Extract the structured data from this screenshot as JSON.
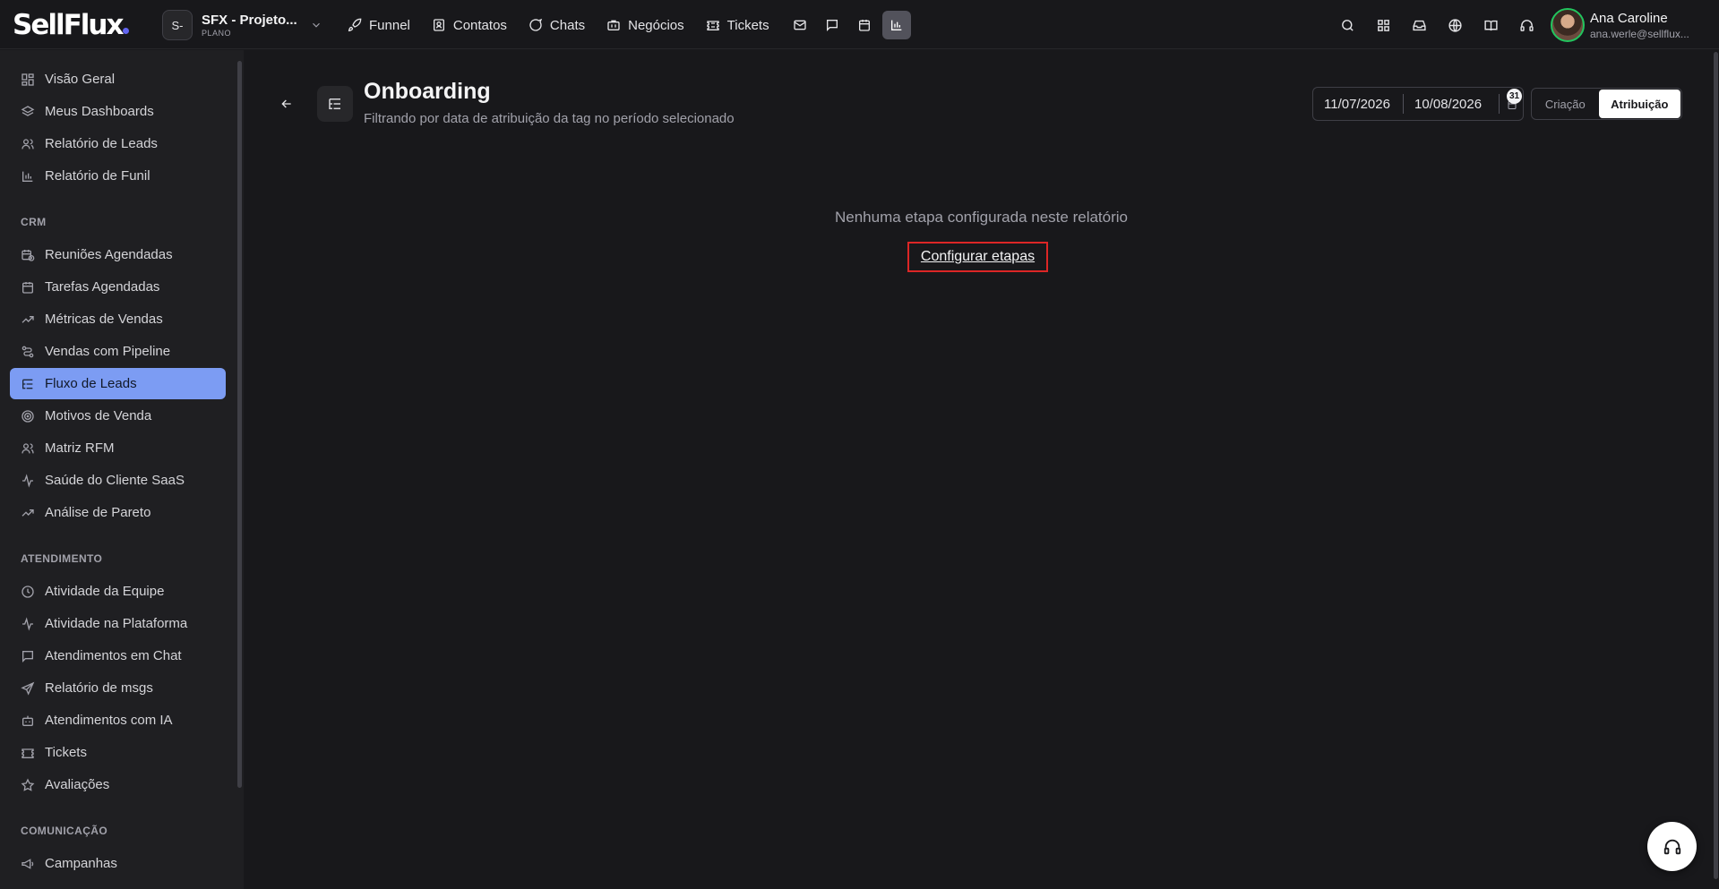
{
  "brand": {
    "logo_text": "SellFlux",
    "accent": "#6366f1"
  },
  "workspace": {
    "initials": "S-",
    "name": "SFX - Projeto...",
    "plan": "PLANO"
  },
  "topnav": {
    "funnel": "Funnel",
    "contatos": "Contatos",
    "chats": "Chats",
    "negocios": "Negócios",
    "tickets": "Tickets",
    "icon_buttons": [
      "mail-icon",
      "message-icon",
      "calendar-icon",
      "bar-chart-icon"
    ],
    "active_icon": "bar-chart-icon"
  },
  "right_icons": [
    "search-icon",
    "apps-grid-icon",
    "inbox-icon",
    "globe-icon",
    "book-icon",
    "headset-icon"
  ],
  "user": {
    "name": "Ana Caroline",
    "email": "ana.werle@sellflux...",
    "status_color": "#22c55e"
  },
  "sidebar": {
    "top_items": [
      "Visão Geral",
      "Meus Dashboards",
      "Relatório de Leads",
      "Relatório de Funil"
    ],
    "crm_title": "CRM",
    "crm_items": [
      "Reuniões Agendadas",
      "Tarefas Agendadas",
      "Métricas de Vendas",
      "Vendas com Pipeline",
      "Fluxo de Leads",
      "Motivos de Venda",
      "Matriz RFM",
      "Saúde do Cliente SaaS",
      "Análise de Pareto"
    ],
    "active_item": "Fluxo de Leads",
    "atendimento_title": "ATENDIMENTO",
    "atendimento_items": [
      "Atividade da Equipe",
      "Atividade na Plataforma",
      "Atendimentos em Chat",
      "Relatório de msgs",
      "Atendimentos com IA",
      "Tickets",
      "Avaliações"
    ],
    "comunicacao_title": "COMUNICAÇÃO",
    "comunicacao_items": [
      "Campanhas"
    ],
    "active_color": "#7c9cf3"
  },
  "page": {
    "title": "Onboarding",
    "subtitle": "Filtrando por data de atribuição da tag no período selecionado",
    "date_start": "11/07/2026",
    "date_end": "10/08/2026",
    "calendar_badge": "31",
    "toggle_options": [
      "Criação",
      "Atribuição"
    ],
    "toggle_selected": "Atribuição",
    "empty_message": "Nenhuma etapa configurada neste relatório",
    "config_link": "Configurar etapas",
    "highlight_color": "#dc2626"
  },
  "support_fab": {
    "icon": "headset-icon"
  }
}
